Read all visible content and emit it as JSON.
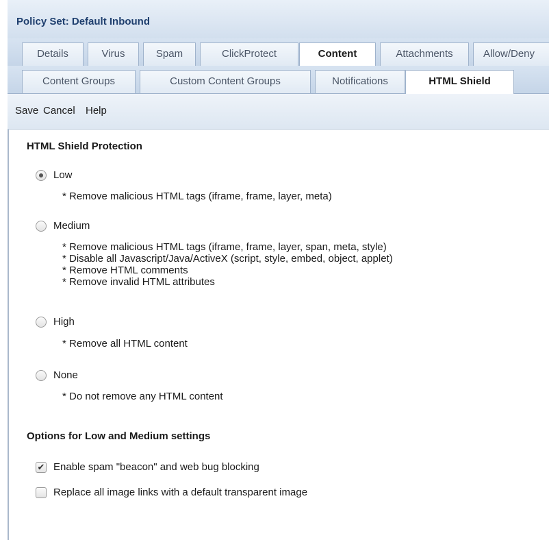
{
  "title": "Policy Set: Default Inbound",
  "tabs_top": [
    {
      "label": "Details",
      "active": false
    },
    {
      "label": "Virus",
      "active": false
    },
    {
      "label": "Spam",
      "active": false
    },
    {
      "label": "ClickProtect",
      "active": false
    },
    {
      "label": "Content",
      "active": true
    },
    {
      "label": "Attachments",
      "active": false
    },
    {
      "label": "Allow/Deny",
      "active": false
    }
  ],
  "tabs_sub": [
    {
      "label": "Content Groups",
      "active": false
    },
    {
      "label": "Custom Content Groups",
      "active": false
    },
    {
      "label": "Notifications",
      "active": false
    },
    {
      "label": "HTML Shield",
      "active": true
    }
  ],
  "toolbar": {
    "save": "Save",
    "cancel": "Cancel",
    "help": "Help"
  },
  "protection": {
    "heading": "HTML Shield Protection",
    "selected": "Low",
    "options": [
      {
        "label": "Low",
        "details": [
          "* Remove malicious HTML tags (iframe, frame, layer, meta)"
        ]
      },
      {
        "label": "Medium",
        "details": [
          "* Remove malicious HTML tags (iframe, frame, layer, span, meta, style)",
          "* Disable all Javascript/Java/ActiveX (script, style, embed, object, applet)",
          "* Remove HTML comments",
          "* Remove invalid HTML attributes"
        ]
      },
      {
        "label": "High",
        "details": [
          "* Remove all HTML content"
        ]
      },
      {
        "label": "None",
        "details": [
          "* Do not remove any HTML content"
        ]
      }
    ]
  },
  "options_section": {
    "heading": "Options for Low and Medium settings",
    "items": [
      {
        "label": "Enable spam \"beacon\" and web bug blocking",
        "checked": true
      },
      {
        "label": "Replace all image links with a default transparent image",
        "checked": false
      }
    ]
  }
}
